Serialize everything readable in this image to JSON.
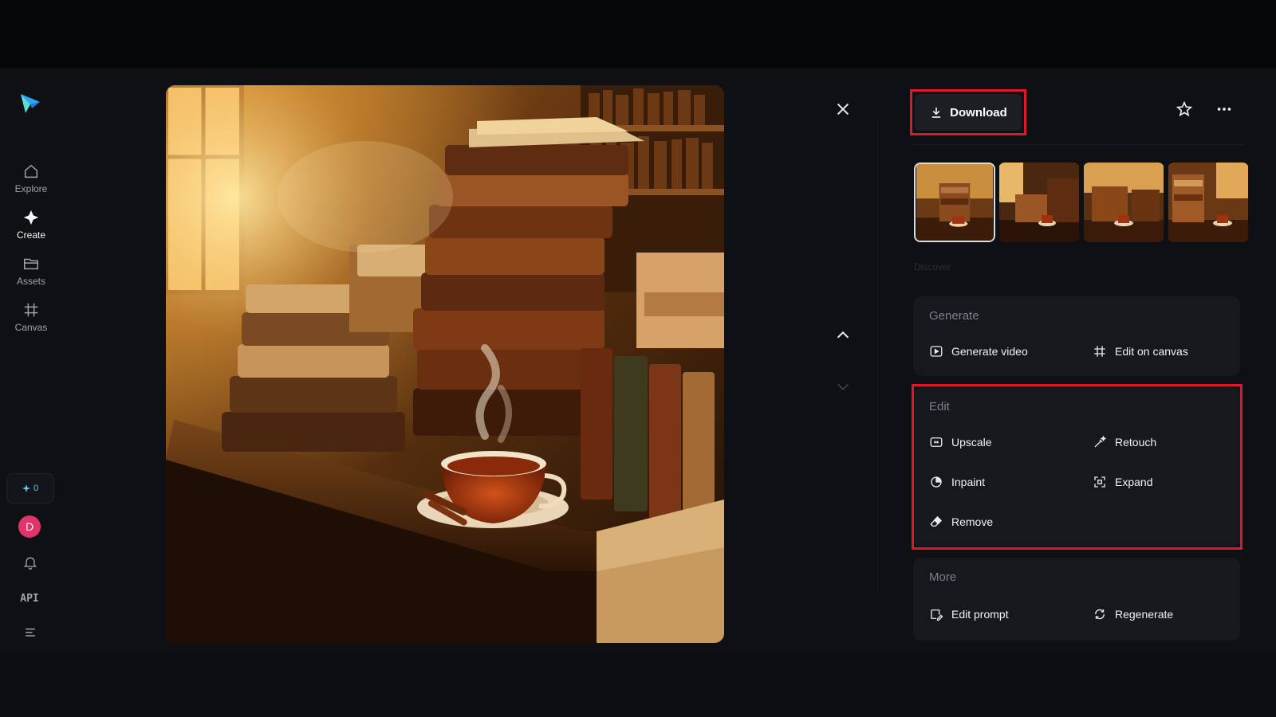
{
  "sidebar": {
    "items": [
      {
        "label": "Explore",
        "icon": "home-icon"
      },
      {
        "label": "Create",
        "icon": "sparkle-icon"
      },
      {
        "label": "Assets",
        "icon": "folder-icon"
      },
      {
        "label": "Canvas",
        "icon": "canvas-icon"
      }
    ],
    "credits": "0",
    "avatar_initial": "D",
    "api_label": "API"
  },
  "panel": {
    "download_label": "Download",
    "faded_label": "Discover",
    "sections": [
      {
        "title": "Generate",
        "actions": [
          {
            "label": "Generate video",
            "icon": "play-icon"
          },
          {
            "label": "Edit on canvas",
            "icon": "crop-icon"
          }
        ]
      },
      {
        "title": "Edit",
        "actions": [
          {
            "label": "Upscale",
            "icon": "upscale-icon"
          },
          {
            "label": "Retouch",
            "icon": "retouch-icon"
          },
          {
            "label": "Inpaint",
            "icon": "inpaint-icon"
          },
          {
            "label": "Expand",
            "icon": "expand-icon"
          },
          {
            "label": "Remove",
            "icon": "eraser-icon"
          }
        ]
      },
      {
        "title": "More",
        "actions": [
          {
            "label": "Edit prompt",
            "icon": "edit-prompt-icon"
          },
          {
            "label": "Regenerate",
            "icon": "regenerate-icon"
          }
        ]
      }
    ]
  },
  "colors": {
    "accent_highlight": "#e0162b",
    "logo_primary": "#2aa8ff",
    "logo_secondary": "#5be0d0",
    "avatar_bg": "#e2336b"
  }
}
